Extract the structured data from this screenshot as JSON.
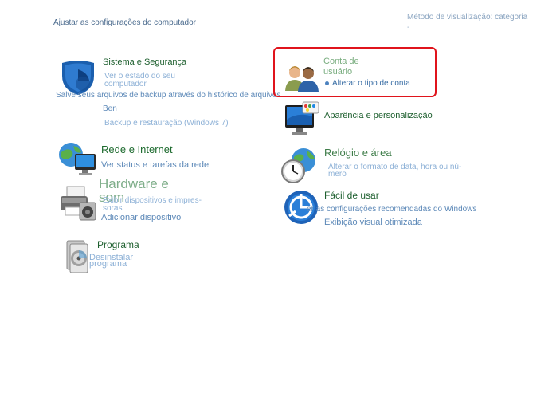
{
  "header": {
    "title": "Ajustar as configurações do computador",
    "view_mode": "Método de visualização: categoria",
    "view_mode_sub": "-"
  },
  "categories": {
    "system_security": {
      "title": "Sistema e Segurança",
      "links": [
        "Ver o estado do seu",
        "computador",
        "Salve seus arquivos de backup através do histórico de arquivos",
        "Ben",
        "Backup e restauração (Windows 7)"
      ]
    },
    "network": {
      "title": "Rede e Internet",
      "links": [
        "Ver status e tarefas da rede"
      ]
    },
    "hardware": {
      "title_line1": "Hardware e",
      "title_line2": "som",
      "links": [
        "Exibir dispositivos e impres-",
        "soras",
        "Adicionar dispositivo"
      ]
    },
    "programs": {
      "title": "Programa",
      "links": [
        "Desinstalar",
        "programa"
      ]
    },
    "user_accounts": {
      "title_line1": "Conta de",
      "title_line2": "usuário",
      "links": [
        "Alterar o tipo de conta"
      ]
    },
    "appearance": {
      "title": "Aparência e personalização"
    },
    "clock_region": {
      "title": "Relógio e área",
      "links": [
        "Alterar o formato de data, hora ou nú-",
        "mero"
      ]
    },
    "ease_of_access": {
      "title": "Fácil de usar",
      "links": [
        "er as configurações recomendadas do Windows",
        "Exibição visual otimizada"
      ]
    }
  },
  "colors": {
    "highlight": "#e0141c",
    "category_title": "#1d5f2e",
    "link": "#4c82bf"
  }
}
